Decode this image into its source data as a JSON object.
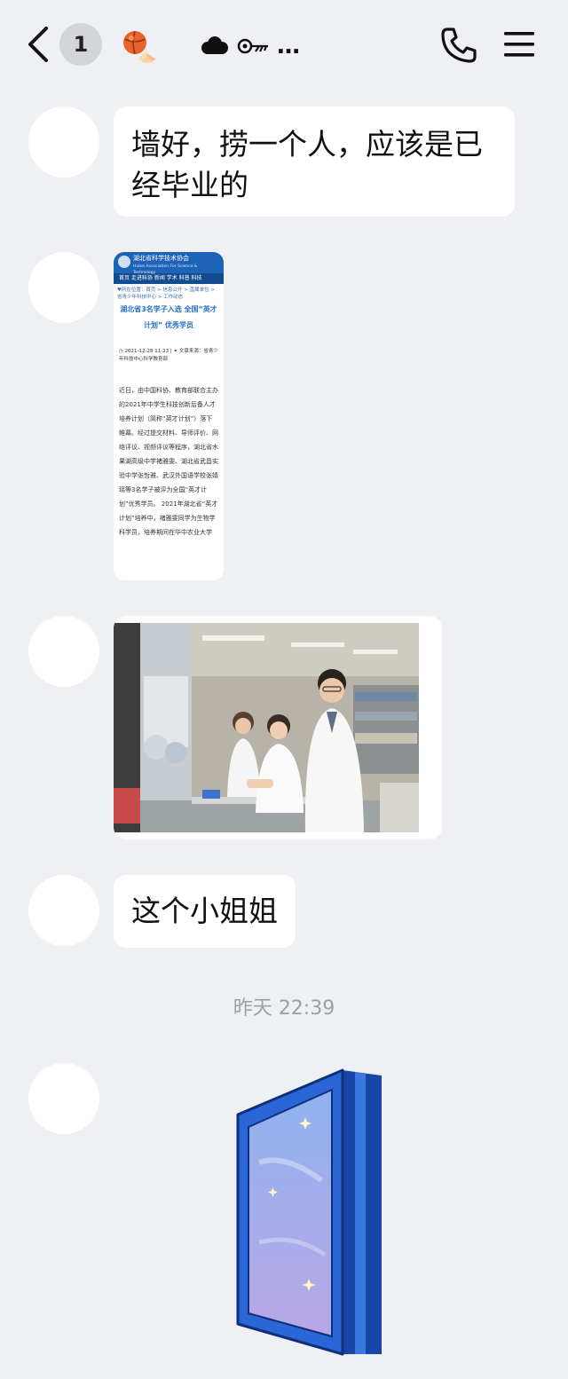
{
  "header": {
    "unread_count": "1",
    "contact_name": "…",
    "fireball_icon": "basketball-fire-icon",
    "back_icon": "chevron-left-icon",
    "phone_icon": "phone-icon",
    "menu_icon": "hamburger-menu-icon"
  },
  "messages": [
    {
      "type": "text",
      "text": "墙好，捞一个人，应该是已经毕业的"
    },
    {
      "type": "article-image",
      "site_name": "湖北省科学技术协会",
      "site_subtitle": "Hubei Association For Science & Technology",
      "nav": "首页  走进科协  新闻  学术  科普  科技",
      "breadcrumb": "♥所在位置：首页 > 信息公开 > 直属单位 > 省青少年科技中心 > 工作动态",
      "title": "湖北省3名学子入选 全国“英才计划” 优秀学员",
      "meta": "◷ 2021-12-28 11:23  |  ⚭ 文章来源：省青少年科技中心科学教育部",
      "body": "近日，由中国科协、教育部联合主办的2021年中学生科技创新后备人才培养计划（简称“英才计划”）落下帷幕。经过提交材料、导师评价、网络评议、视频评议等程序，湖北省水果湖高级中学褚雅雯、湖北省武昌实验中学张哲雅、武汉外国语学校张婧瑶等3名学子被评为全国“英才计划”优秀学员。 2021年湖北省“英才计划”培养中，褚雅雯同学为生物学科学员，培养期间在华中农业大学"
    },
    {
      "type": "photo",
      "description_icon": "lab-photo-icon"
    },
    {
      "type": "text",
      "text": "这个小姐姐"
    }
  ],
  "timestamp": "昨天 22:39",
  "sticker": {
    "icon": "blue-window-sticker-icon"
  },
  "colors": {
    "background": "#eef0f4",
    "bubble": "#ffffff",
    "timestamp": "#9aa0a8",
    "sticker_blue": "#1f5fc9"
  }
}
